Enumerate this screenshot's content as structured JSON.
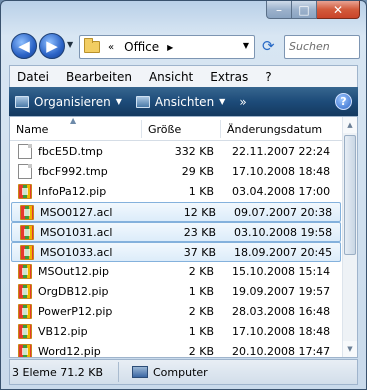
{
  "window": {
    "caption": {
      "minimize": "–",
      "maximize": "□",
      "close": "✕"
    }
  },
  "nav": {
    "back": "◀",
    "forward": "▶",
    "dropdown": "▼",
    "breadcrumb_sep": "«",
    "folder": "Office",
    "crumb_arrow": "▶",
    "refresh": "⟳",
    "search_placeholder": "Suchen"
  },
  "menubar": {
    "items": [
      "Datei",
      "Bearbeiten",
      "Ansicht",
      "Extras",
      "?"
    ]
  },
  "cmdbar": {
    "organize": "Organisieren",
    "views": "Ansichten",
    "more": "»",
    "help": "?"
  },
  "columns": {
    "name": "Name",
    "size": "Größe",
    "date": "Änderungsdatum"
  },
  "files": [
    {
      "name": "fbcE5D.tmp",
      "size": "332 KB",
      "date": "22.11.2007 22:24",
      "icon": "doc",
      "selected": false
    },
    {
      "name": "fbcF992.tmp",
      "size": "29 KB",
      "date": "17.10.2008 18:48",
      "icon": "doc",
      "selected": false
    },
    {
      "name": "InfoPa12.pip",
      "size": "1 KB",
      "date": "03.04.2008 17:00",
      "icon": "pip",
      "selected": false
    },
    {
      "name": "MSO0127.acl",
      "size": "12 KB",
      "date": "09.07.2007 20:38",
      "icon": "pip",
      "selected": true
    },
    {
      "name": "MSO1031.acl",
      "size": "23 KB",
      "date": "03.10.2008 19:58",
      "icon": "pip",
      "selected": true
    },
    {
      "name": "MSO1033.acl",
      "size": "37 KB",
      "date": "18.09.2007 20:45",
      "icon": "pip",
      "selected": true
    },
    {
      "name": "MSOut12.pip",
      "size": "2 KB",
      "date": "15.10.2008 15:14",
      "icon": "pip",
      "selected": false
    },
    {
      "name": "OrgDB12.pip",
      "size": "1 KB",
      "date": "19.09.2007 19:57",
      "icon": "pip",
      "selected": false
    },
    {
      "name": "PowerP12.pip",
      "size": "2 KB",
      "date": "28.03.2008 16:48",
      "icon": "pip",
      "selected": false
    },
    {
      "name": "VB12.pip",
      "size": "1 KB",
      "date": "17.10.2008 18:48",
      "icon": "pip",
      "selected": false
    },
    {
      "name": "Word12.pip",
      "size": "2 KB",
      "date": "20.10.2008 17:47",
      "icon": "pip",
      "selected": false
    }
  ],
  "status": {
    "left": "3 Eleme 71.2 KB",
    "location": "Computer"
  }
}
